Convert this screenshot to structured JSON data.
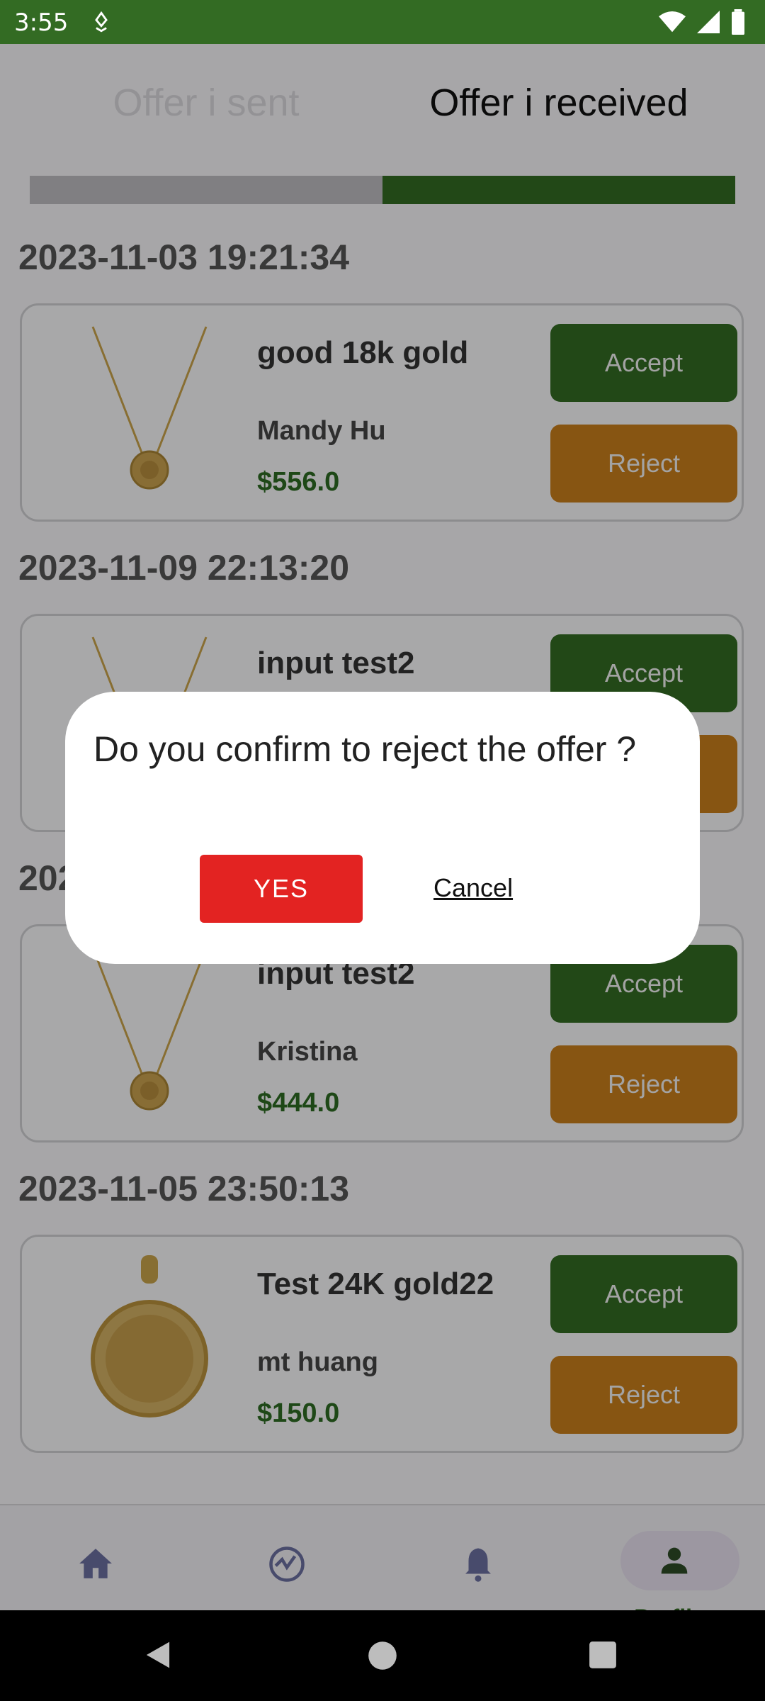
{
  "status": {
    "time": "3:55"
  },
  "tabs": {
    "sent": "Offer i sent",
    "received": "Offer i received"
  },
  "offers": [
    {
      "date": "2023-11-03 19:21:34",
      "title": "good 18k gold",
      "buyer": "Mandy Hu",
      "price": "$556.0",
      "accept": "Accept",
      "reject": "Reject"
    },
    {
      "date": "2023-11-09 22:13:20",
      "title": "input test2",
      "buyer": "",
      "price": "",
      "accept": "Accept",
      "reject": "Reject"
    },
    {
      "date": "202",
      "title": "input test2",
      "buyer": "Kristina",
      "price": "$444.0",
      "accept": "Accept",
      "reject": "Reject"
    },
    {
      "date": "2023-11-05 23:50:13",
      "title": "Test 24K gold22",
      "buyer": "mt huang",
      "price": "$150.0",
      "accept": "Accept",
      "reject": "Reject"
    }
  ],
  "bottom_nav": {
    "profile": "Profile"
  },
  "dialog": {
    "message": "Do you confirm to reject the offer ?",
    "yes": "YES",
    "cancel": "Cancel"
  }
}
